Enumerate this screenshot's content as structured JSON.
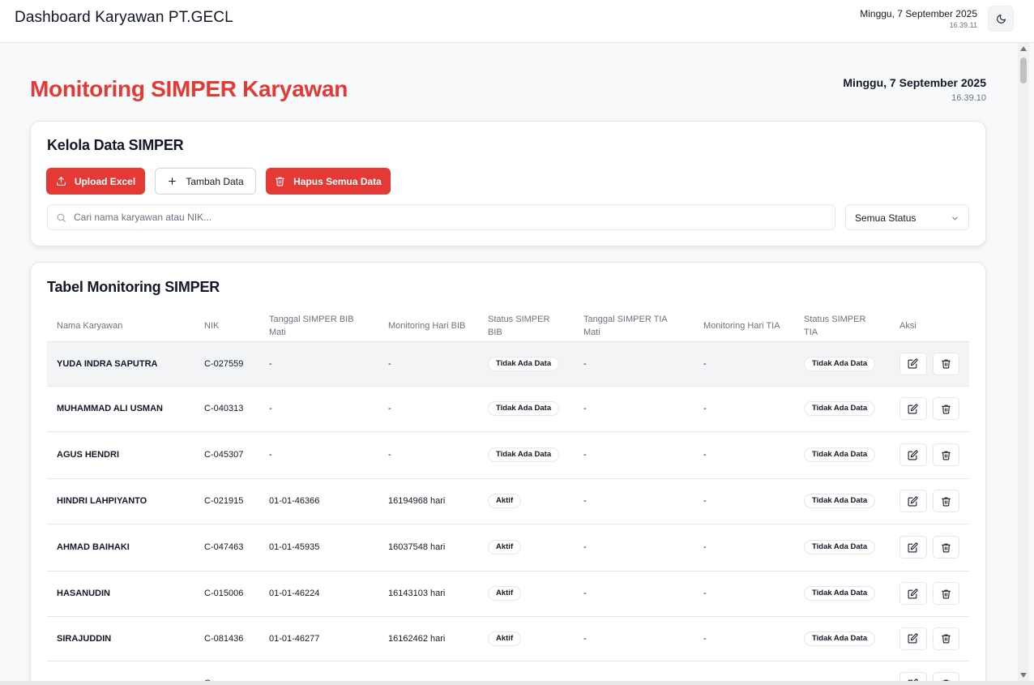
{
  "app": {
    "title": "Dashboard Karyawan PT.GECL",
    "date": "Minggu, 7 September 2025",
    "time": "16.39.11",
    "theme_icon": "moon-icon"
  },
  "page": {
    "title": "Monitoring SIMPER Karyawan",
    "date": "Minggu, 7 September 2025",
    "time": "16.39.10"
  },
  "manage": {
    "title": "Kelola Data SIMPER",
    "upload_label": "Upload Excel",
    "add_label": "Tambah Data",
    "delete_all_label": "Hapus Semua Data",
    "search_placeholder": "Cari nama karyawan atau NIK...",
    "status_filter": "Semua Status"
  },
  "table": {
    "title": "Tabel Monitoring SIMPER",
    "headers": [
      "Nama Karyawan",
      "NIK",
      "Tanggal SIMPER BIB Mati",
      "Monitoring Hari BIB",
      "Status SIMPER BIB",
      "Tanggal SIMPER TIA Mati",
      "Monitoring Hari TIA",
      "Status SIMPER TIA",
      "Aksi"
    ],
    "rows": [
      {
        "name": "YUDA INDRA SAPUTRA",
        "nik": "C-027559",
        "bib_date": "-",
        "bib_days": "-",
        "bib_status": "Tidak Ada Data",
        "tia_date": "-",
        "tia_days": "-",
        "tia_status": "Tidak Ada Data"
      },
      {
        "name": "MUHAMMAD ALI USMAN",
        "nik": "C-040313",
        "bib_date": "-",
        "bib_days": "-",
        "bib_status": "Tidak Ada Data",
        "tia_date": "-",
        "tia_days": "-",
        "tia_status": "Tidak Ada Data"
      },
      {
        "name": "AGUS HENDRI",
        "nik": "C-045307",
        "bib_date": "-",
        "bib_days": "-",
        "bib_status": "Tidak Ada Data",
        "tia_date": "-",
        "tia_days": "-",
        "tia_status": "Tidak Ada Data"
      },
      {
        "name": "HINDRI LAHPIYANTO",
        "nik": "C-021915",
        "bib_date": "01-01-46366",
        "bib_days": "16194968 hari",
        "bib_status": "Aktif",
        "tia_date": "-",
        "tia_days": "-",
        "tia_status": "Tidak Ada Data"
      },
      {
        "name": "AHMAD BAIHAKI",
        "nik": "C-047463",
        "bib_date": "01-01-45935",
        "bib_days": "16037548 hari",
        "bib_status": "Aktif",
        "tia_date": "-",
        "tia_days": "-",
        "tia_status": "Tidak Ada Data"
      },
      {
        "name": "HASANUDIN",
        "nik": "C-015006",
        "bib_date": "01-01-46224",
        "bib_days": "16143103 hari",
        "bib_status": "Aktif",
        "tia_date": "-",
        "tia_days": "-",
        "tia_status": "Tidak Ada Data"
      },
      {
        "name": "SIRAJUDDIN",
        "nik": "C-081436",
        "bib_date": "01-01-46277",
        "bib_days": "16162462 hari",
        "bib_status": "Aktif",
        "tia_date": "-",
        "tia_days": "-",
        "tia_status": "Tidak Ada Data"
      },
      {
        "name": "",
        "nik": "C-",
        "bib_date": "",
        "bib_days": "",
        "bib_status": "",
        "tia_date": "",
        "tia_days": "",
        "tia_status": ""
      }
    ]
  }
}
